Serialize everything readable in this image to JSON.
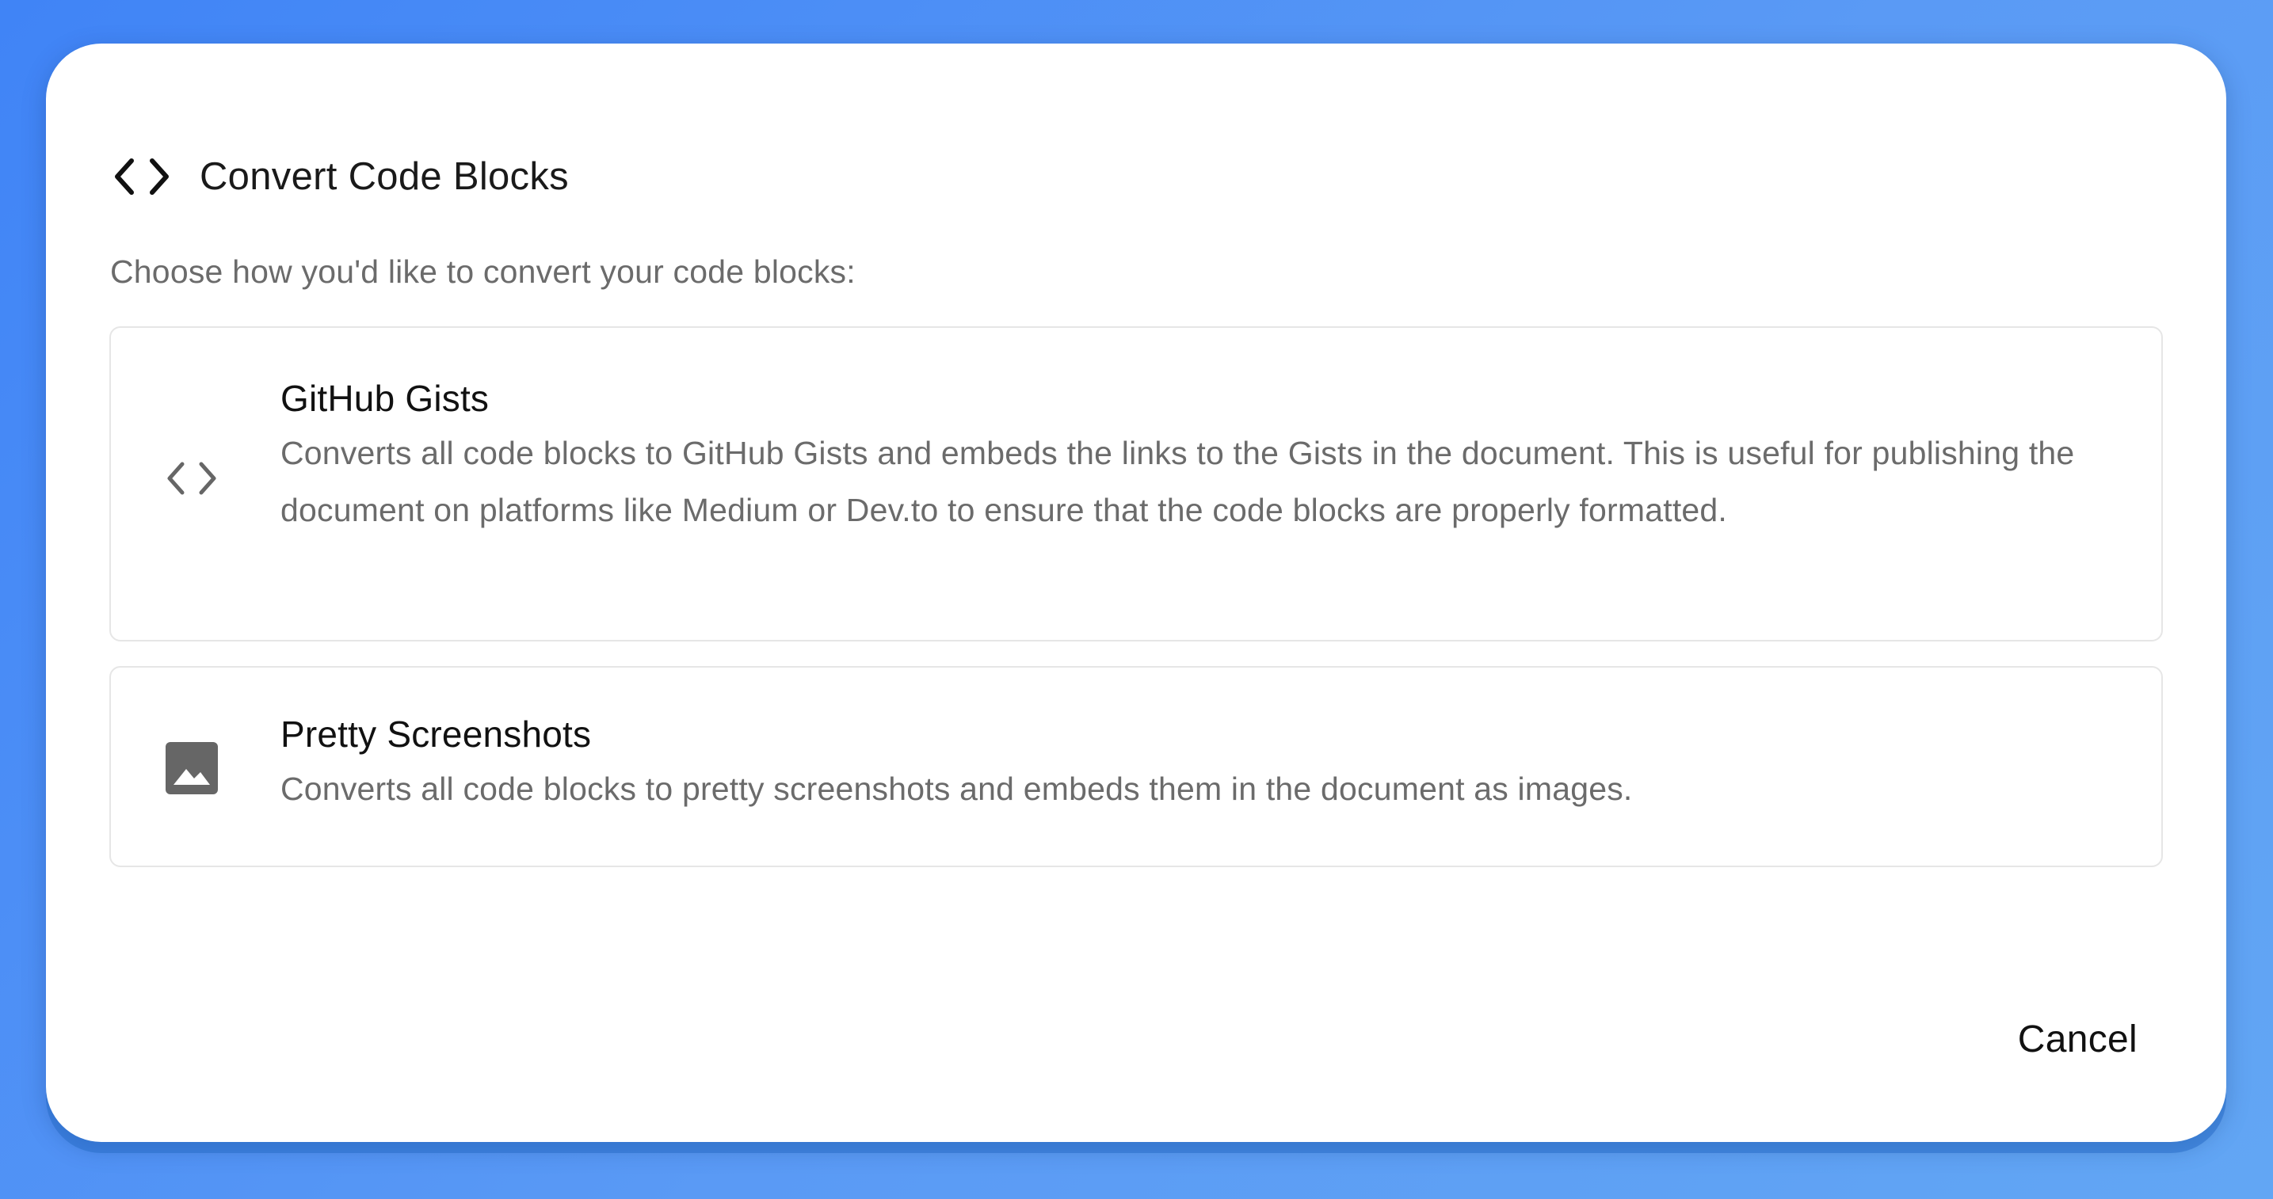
{
  "dialog": {
    "title": "Convert Code Blocks",
    "title_icon": "code-brackets-icon",
    "subtitle": "Choose how you'd like to convert your code blocks:",
    "options": [
      {
        "icon": "code-brackets-icon",
        "title": "GitHub Gists",
        "description": "Converts all code blocks to GitHub Gists and embeds the links to the Gists in the document. This is useful for publishing the document on platforms like Medium or Dev.to to ensure that the code blocks are properly formatted."
      },
      {
        "icon": "image-icon",
        "title": "Pretty Screenshots",
        "description": "Converts all code blocks to pretty screenshots and embeds them in the document as images."
      }
    ],
    "cancel_label": "Cancel"
  },
  "colors": {
    "background_start": "#4084f6",
    "background_end": "#62a6f4",
    "dialog_bg": "#ffffff",
    "title_text": "#1a1a1a",
    "muted_text": "#6b6b6b",
    "card_border": "#e6e6e6",
    "icon_gray": "#666666"
  }
}
